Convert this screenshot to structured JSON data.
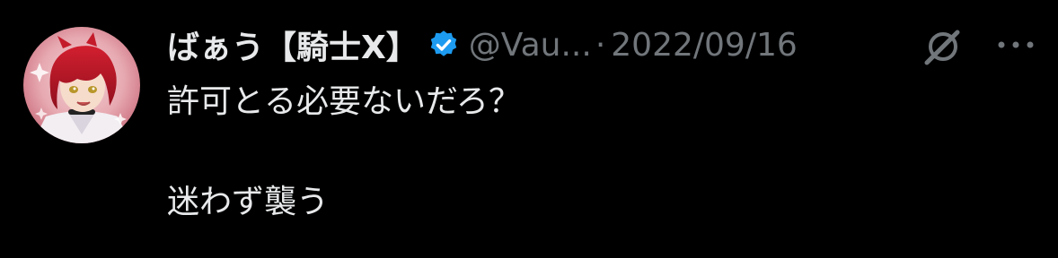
{
  "tweet": {
    "author": {
      "display_name": "ばぁう【騎士X】",
      "handle": "@Vau...",
      "verified": true,
      "avatar_icon": "avatar-red-haired-character"
    },
    "separator": "·",
    "date": "2022/09/16",
    "text_lines": [
      "許可とる必要ないだろ？",
      "",
      "迷わず襲う"
    ],
    "icons": {
      "grok": "grok-icon",
      "more": "more-options-icon",
      "verified": "verified-badge-icon"
    }
  },
  "colors": {
    "background": "#000000",
    "primary_text": "#e7e9ea",
    "secondary_text": "#71767b",
    "verified_blue": "#1d9bf0"
  }
}
